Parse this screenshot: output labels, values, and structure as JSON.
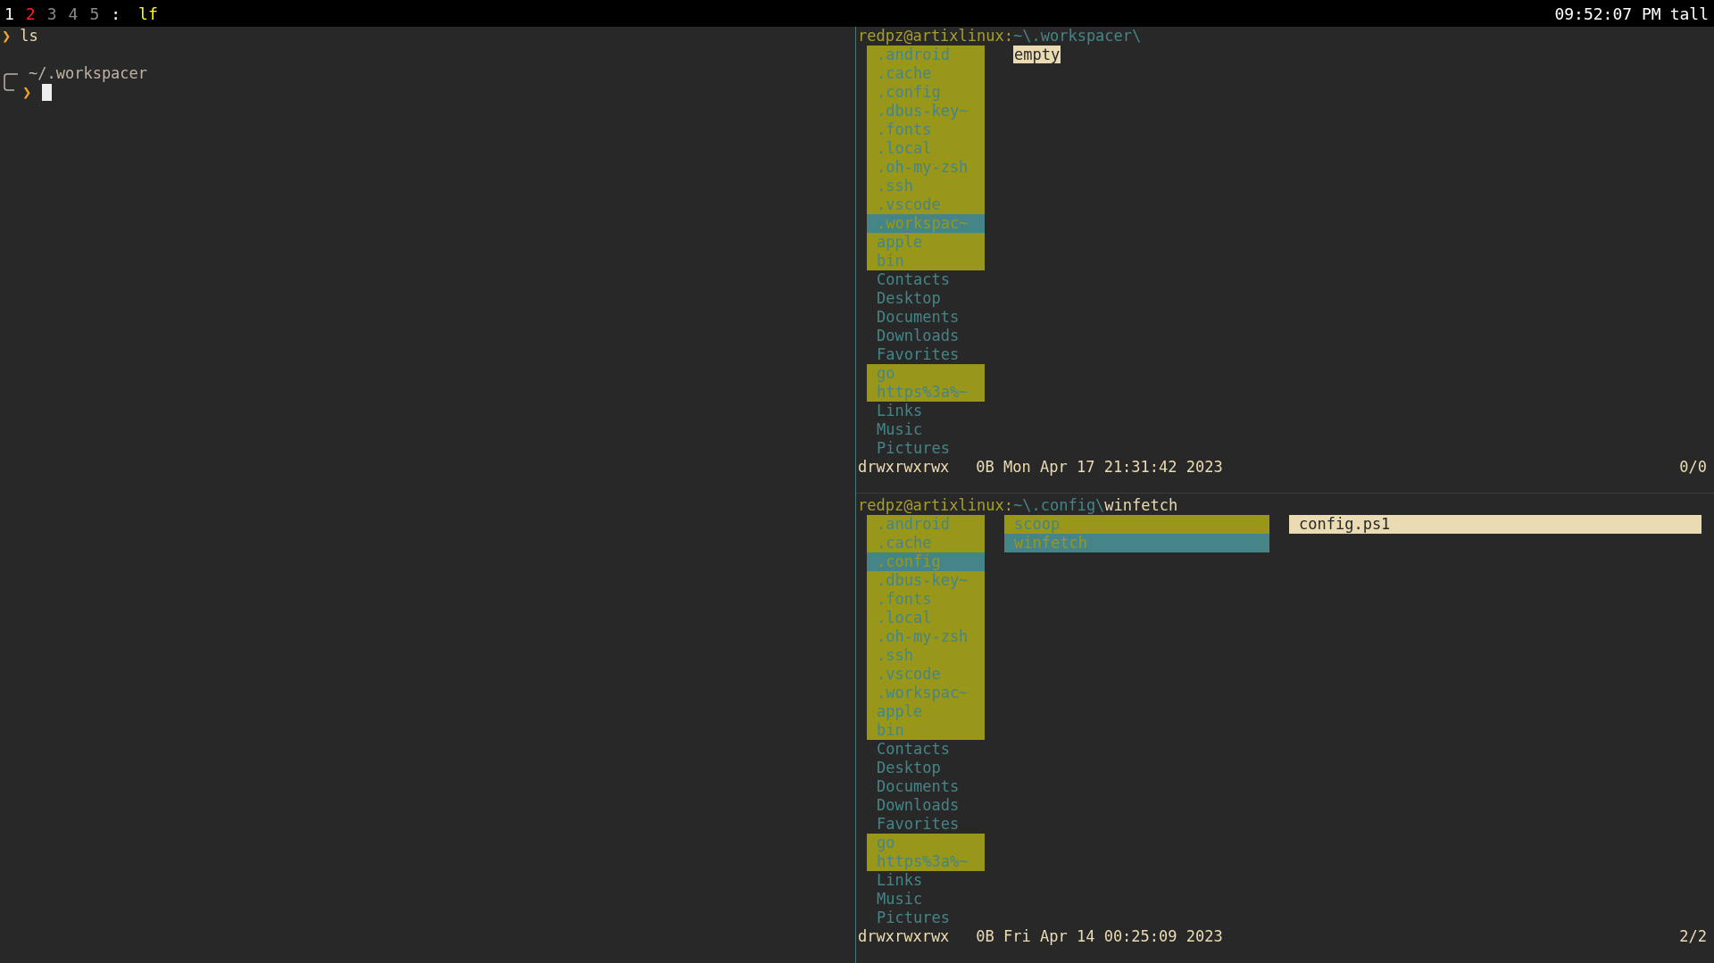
{
  "top_bar": {
    "workspaces": [
      {
        "label": "1",
        "focused": true,
        "urgent": false
      },
      {
        "label": "2",
        "focused": false,
        "urgent": true
      },
      {
        "label": "3",
        "focused": false,
        "urgent": false
      },
      {
        "label": "4",
        "focused": false,
        "urgent": false
      },
      {
        "label": "5",
        "focused": false,
        "urgent": false
      }
    ],
    "separator": ":",
    "title": "lf",
    "clock": "09:52:07 PM",
    "layout": "tall"
  },
  "terminal": {
    "lines": [
      {
        "kind": "command",
        "prompt": "❯",
        "text": "ls"
      },
      {
        "kind": "blank"
      },
      {
        "kind": "path",
        "text": "~/.workspacer"
      },
      {
        "kind": "input",
        "prompt": "❯",
        "cursor": true
      }
    ]
  },
  "file_panes": [
    {
      "path": {
        "host": "redpz@artixlinux:",
        "dir": "~\\.workspacer\\"
      },
      "columns": [
        {
          "kind": "list",
          "entries": [
            {
              "name": ".android",
              "kind": "dir",
              "highlighted": true,
              "selected": false
            },
            {
              "name": ".cache",
              "kind": "dir",
              "highlighted": true,
              "selected": false
            },
            {
              "name": ".config",
              "kind": "dir",
              "highlighted": true,
              "selected": false
            },
            {
              "name": ".dbus-key~",
              "kind": "dir",
              "highlighted": true,
              "selected": false
            },
            {
              "name": ".fonts",
              "kind": "dir",
              "highlighted": true,
              "selected": false
            },
            {
              "name": ".local",
              "kind": "dir",
              "highlighted": true,
              "selected": false
            },
            {
              "name": ".oh-my-zsh",
              "kind": "dir",
              "highlighted": true,
              "selected": false
            },
            {
              "name": ".ssh",
              "kind": "dir",
              "highlighted": true,
              "selected": false
            },
            {
              "name": ".vscode",
              "kind": "dir",
              "highlighted": true,
              "selected": false
            },
            {
              "name": ".workspac~",
              "kind": "dir",
              "highlighted": true,
              "selected": true
            },
            {
              "name": "apple",
              "kind": "dir",
              "highlighted": true,
              "selected": false
            },
            {
              "name": "bin",
              "kind": "dir",
              "highlighted": true,
              "selected": false
            },
            {
              "name": "Contacts",
              "kind": "dir",
              "highlighted": false,
              "selected": false
            },
            {
              "name": "Desktop",
              "kind": "dir",
              "highlighted": false,
              "selected": false
            },
            {
              "name": "Documents",
              "kind": "dir",
              "highlighted": false,
              "selected": false
            },
            {
              "name": "Downloads",
              "kind": "dir",
              "highlighted": false,
              "selected": false
            },
            {
              "name": "Favorites",
              "kind": "dir",
              "highlighted": false,
              "selected": false
            },
            {
              "name": "go",
              "kind": "dir",
              "highlighted": true,
              "selected": false
            },
            {
              "name": "https%3a%~",
              "kind": "dir",
              "highlighted": true,
              "selected": false
            },
            {
              "name": "Links",
              "kind": "dir",
              "highlighted": false,
              "selected": false
            },
            {
              "name": "Music",
              "kind": "dir",
              "highlighted": false,
              "selected": false
            },
            {
              "name": "Pictures",
              "kind": "dir",
              "highlighted": false,
              "selected": false
            }
          ]
        },
        {
          "kind": "message",
          "text": "empty"
        }
      ],
      "status": {
        "mode": "drwxrwxrwx",
        "details": "0B Mon Apr 17 21:31:42 2023",
        "position": "0/0"
      }
    },
    {
      "path": {
        "host": "redpz@artixlinux:",
        "dir": "~\\.config\\",
        "file": "winfetch"
      },
      "columns": [
        {
          "kind": "list",
          "entries": [
            {
              "name": ".android",
              "kind": "dir",
              "highlighted": true,
              "selected": false
            },
            {
              "name": ".cache",
              "kind": "dir",
              "highlighted": true,
              "selected": false
            },
            {
              "name": ".config",
              "kind": "dir",
              "highlighted": true,
              "selected": true
            },
            {
              "name": ".dbus-key~",
              "kind": "dir",
              "highlighted": true,
              "selected": false
            },
            {
              "name": ".fonts",
              "kind": "dir",
              "highlighted": true,
              "selected": false
            },
            {
              "name": ".local",
              "kind": "dir",
              "highlighted": true,
              "selected": false
            },
            {
              "name": ".oh-my-zsh",
              "kind": "dir",
              "highlighted": true,
              "selected": false
            },
            {
              "name": ".ssh",
              "kind": "dir",
              "highlighted": true,
              "selected": false
            },
            {
              "name": ".vscode",
              "kind": "dir",
              "highlighted": true,
              "selected": false
            },
            {
              "name": ".workspac~",
              "kind": "dir",
              "highlighted": true,
              "selected": false
            },
            {
              "name": "apple",
              "kind": "dir",
              "highlighted": true,
              "selected": false
            },
            {
              "name": "bin",
              "kind": "dir",
              "highlighted": true,
              "selected": false
            },
            {
              "name": "Contacts",
              "kind": "dir",
              "highlighted": false,
              "selected": false
            },
            {
              "name": "Desktop",
              "kind": "dir",
              "highlighted": false,
              "selected": false
            },
            {
              "name": "Documents",
              "kind": "dir",
              "highlighted": false,
              "selected": false
            },
            {
              "name": "Downloads",
              "kind": "dir",
              "highlighted": false,
              "selected": false
            },
            {
              "name": "Favorites",
              "kind": "dir",
              "highlighted": false,
              "selected": false
            },
            {
              "name": "go",
              "kind": "dir",
              "highlighted": true,
              "selected": false
            },
            {
              "name": "https%3a%~",
              "kind": "dir",
              "highlighted": true,
              "selected": false
            },
            {
              "name": "Links",
              "kind": "dir",
              "highlighted": false,
              "selected": false
            },
            {
              "name": "Music",
              "kind": "dir",
              "highlighted": false,
              "selected": false
            },
            {
              "name": "Pictures",
              "kind": "dir",
              "highlighted": false,
              "selected": false
            }
          ]
        },
        {
          "kind": "list",
          "entries": [
            {
              "name": "scoop",
              "kind": "dir",
              "highlighted": true,
              "selected": false
            },
            {
              "name": "winfetch",
              "kind": "dir",
              "highlighted": true,
              "selected": true
            }
          ]
        },
        {
          "kind": "list",
          "entries": [
            {
              "name": "config.ps1",
              "kind": "file",
              "selected": true
            }
          ]
        }
      ],
      "status": {
        "mode": "drwxrwxrwx",
        "details": "0B Fri Apr 14 00:25:09 2023",
        "position": "2/2"
      }
    }
  ]
}
